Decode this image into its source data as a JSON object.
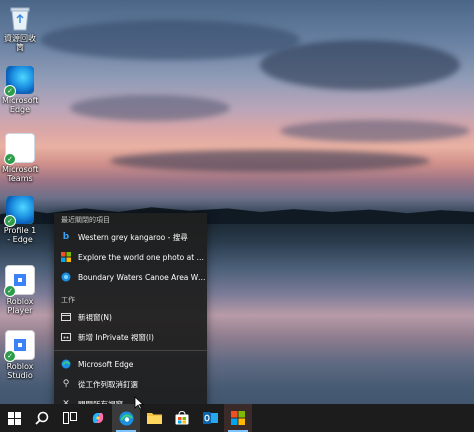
{
  "desktop": {
    "icons": [
      {
        "label": "資源回收筒",
        "icon": "recycle-bin-icon"
      },
      {
        "label": "Microsoft Edge",
        "icon": "edge-icon"
      },
      {
        "label": "Microsoft Teams",
        "icon": "teams-icon"
      },
      {
        "label": "Profile 1 - Edge",
        "icon": "edge-profile-icon"
      },
      {
        "label": "Roblox Player",
        "icon": "roblox-player-icon"
      },
      {
        "label": "Roblox Studio",
        "icon": "roblox-studio-icon"
      }
    ]
  },
  "jumplist": {
    "recent_header": "最近關閉的項目",
    "recent": [
      {
        "text": "Western grey kangaroo - 搜尋",
        "icon": "bing-icon"
      },
      {
        "text": "Explore the world one photo at a ti...",
        "icon": "windows-spotlight-icon"
      },
      {
        "text": "Boundary Waters Canoe Area Wilde...",
        "icon": "bing-icon"
      }
    ],
    "tasks_header": "工作",
    "tasks": [
      {
        "text": "新視窗(N)",
        "icon": "new-window-icon"
      },
      {
        "text": "新增 InPrivate 視窗(I)",
        "icon": "inprivate-icon"
      }
    ],
    "app_actions": [
      {
        "text": "Microsoft Edge",
        "icon": "edge-icon"
      },
      {
        "text": "從工作列取消釘選",
        "icon": "unpin-icon"
      },
      {
        "text": "關閉所有視窗",
        "icon": "close-icon"
      }
    ]
  },
  "taskbar": {
    "items": [
      {
        "name": "start",
        "icon": "windows-start-icon"
      },
      {
        "name": "search",
        "icon": "search-icon"
      },
      {
        "name": "task-view",
        "icon": "task-view-icon"
      },
      {
        "name": "copilot",
        "icon": "copilot-icon"
      },
      {
        "name": "edge",
        "icon": "edge-icon"
      },
      {
        "name": "file-explorer",
        "icon": "folder-icon"
      },
      {
        "name": "store",
        "icon": "store-icon"
      },
      {
        "name": "outlook",
        "icon": "outlook-icon"
      },
      {
        "name": "spotlight",
        "icon": "windows-spotlight-icon"
      }
    ]
  },
  "colors": {
    "taskbar": "#1c1c1c",
    "jumplist": "#202020",
    "accent": "#7cc4ff"
  }
}
